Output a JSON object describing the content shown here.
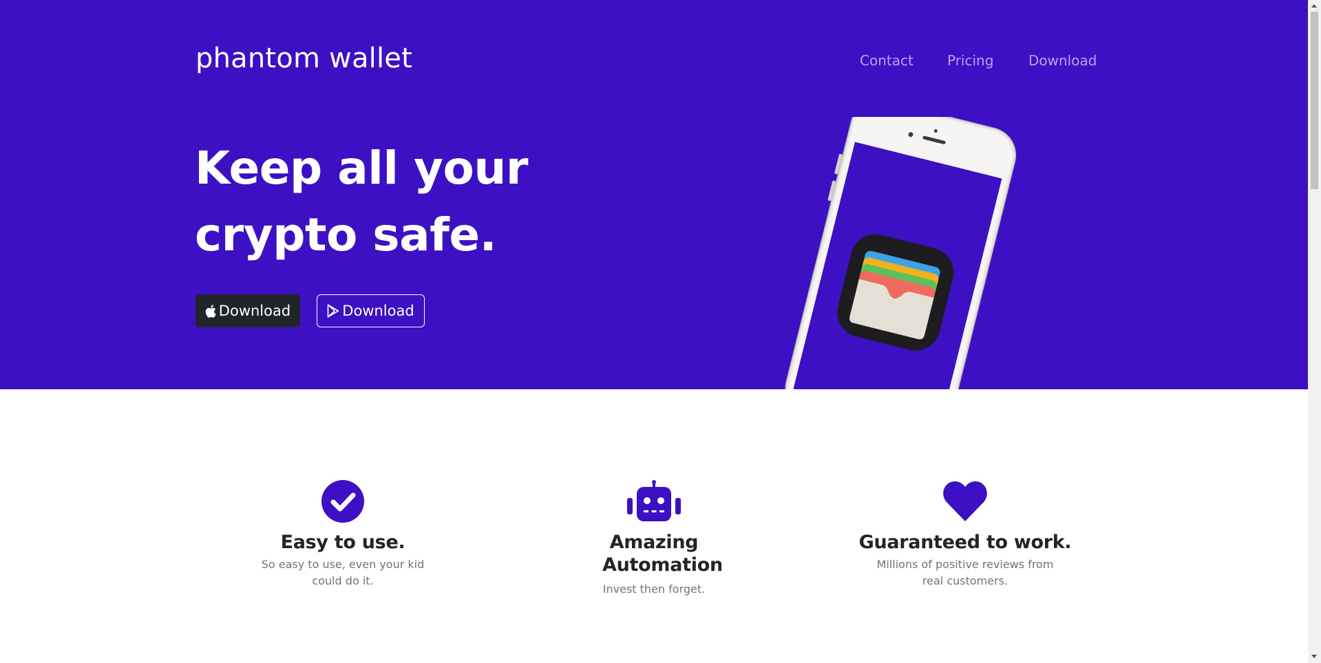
{
  "colors": {
    "hero_background": "#3d10c4",
    "accent": "#3d10c4",
    "nav_link": "#b4a6ee",
    "dark_button": "#212529",
    "heading_text": "#212529",
    "body_text": "#6c757d"
  },
  "header": {
    "brand": "phantom wallet",
    "nav": {
      "contact": "Contact",
      "pricing": "Pricing",
      "download": "Download"
    }
  },
  "hero": {
    "headline_line1": "Keep all your",
    "headline_line2": "crypto safe.",
    "buttons": {
      "apple": {
        "label": "Download",
        "icon": "apple-icon"
      },
      "play": {
        "label": "Download",
        "icon": "google-play-icon"
      }
    },
    "illustration": "phone-with-wallet-app"
  },
  "features": [
    {
      "icon": "check-circle-icon",
      "title": "Easy to use.",
      "description": "So easy to use, even your kid could do it."
    },
    {
      "icon": "robot-icon",
      "title": "Amazing Automation",
      "description": "Invest then forget."
    },
    {
      "icon": "heart-icon",
      "title": "Guaranteed to work.",
      "description": "Millions of positive reviews from real customers."
    }
  ]
}
